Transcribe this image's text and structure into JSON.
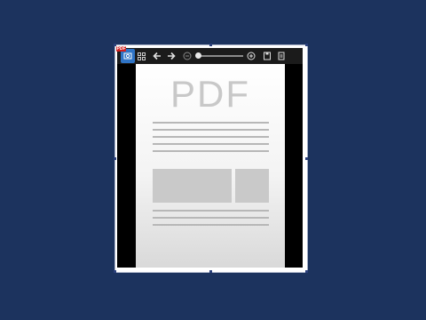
{
  "app": {
    "badge": "PDF"
  },
  "toolbar": {
    "icons": [
      "image-icon",
      "grid-icon",
      "arrow-left-icon",
      "arrow-right-icon",
      "zoom-out-icon",
      "zoom-in-icon",
      "save-icon",
      "document-icon"
    ]
  },
  "document": {
    "title": "PDF"
  },
  "colors": {
    "background": "#1c335e",
    "toolbar": "#1b1b1b",
    "accent": "#2f74c6",
    "badge": "#d11f1f"
  }
}
